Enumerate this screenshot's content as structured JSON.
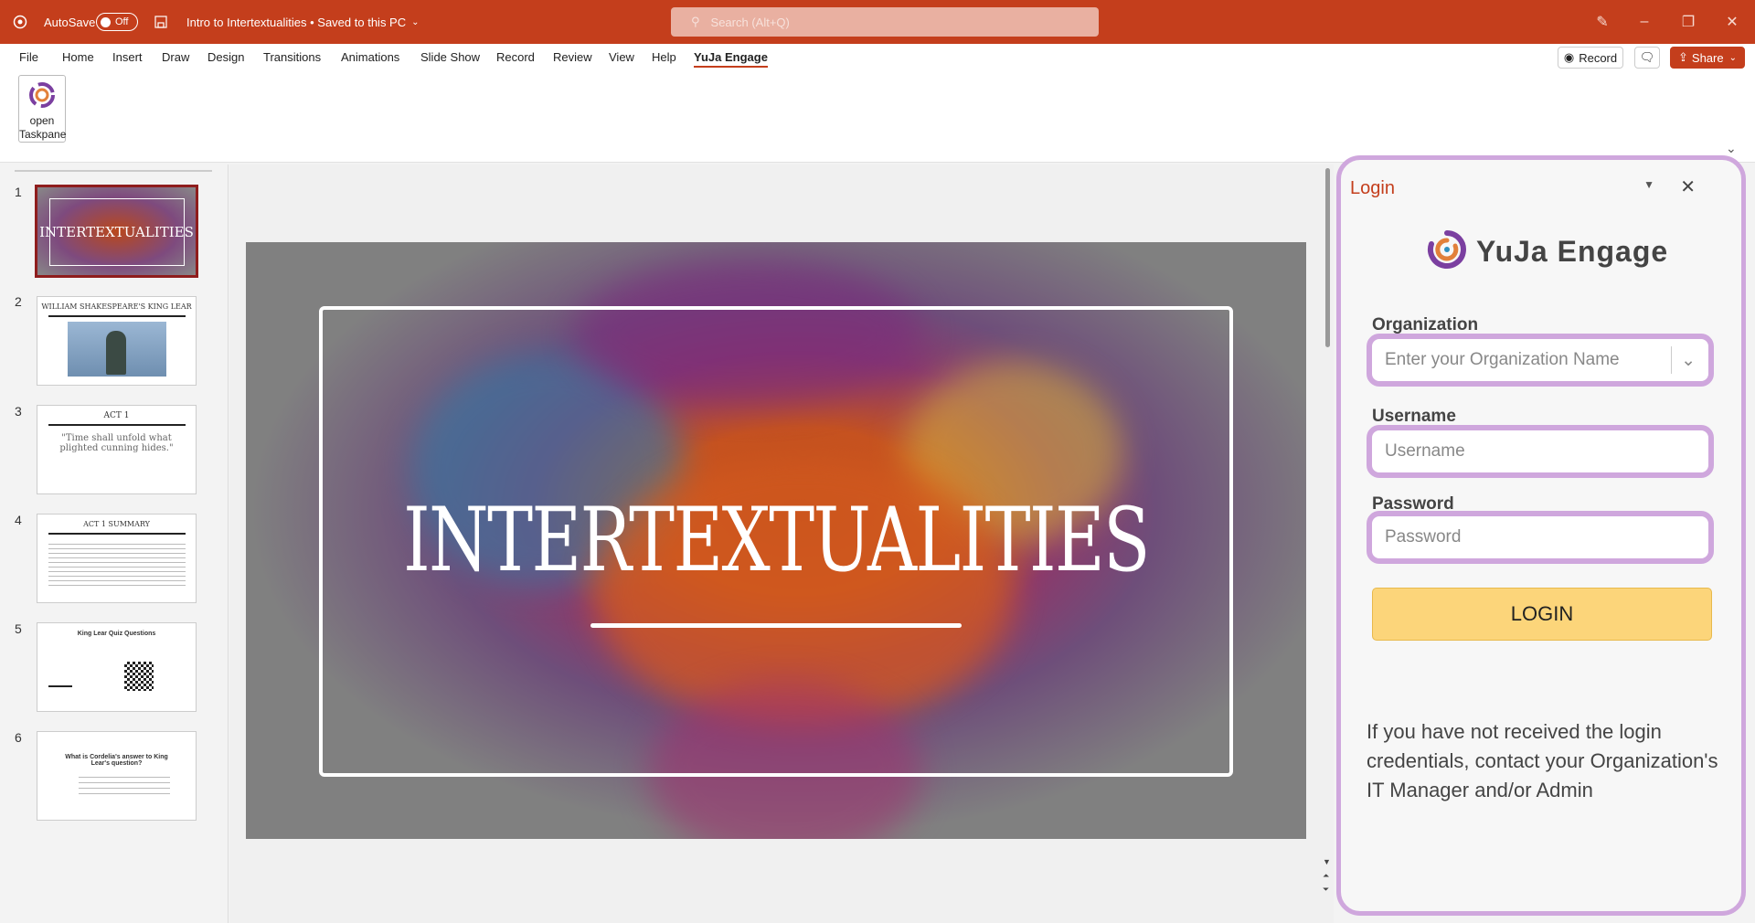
{
  "titlebar": {
    "autosave_label": "AutoSave",
    "autosave_state": "Off",
    "document_title": "Intro to Intertextualities • Saved to this PC",
    "search_placeholder": "Search (Alt+Q)"
  },
  "menu": {
    "tabs": [
      "File",
      "Home",
      "Insert",
      "Draw",
      "Design",
      "Transitions",
      "Animations",
      "Slide Show",
      "Record",
      "Review",
      "View",
      "Help",
      "YuJa Engage"
    ],
    "active_tab": "YuJa Engage",
    "record_label": "Record",
    "share_label": "Share"
  },
  "ribbon": {
    "taskpane_line1": "open",
    "taskpane_line2": "Taskpane"
  },
  "slides": [
    {
      "num": "1",
      "title": "INTERTEXTUALITIES"
    },
    {
      "num": "2",
      "title": "WILLIAM SHAKESPEARE'S KING LEAR"
    },
    {
      "num": "3",
      "title": "ACT 1",
      "quote": "\"Time shall unfold what plighted cunning hides.\""
    },
    {
      "num": "4",
      "title": "ACT 1 SUMMARY"
    },
    {
      "num": "5",
      "title": "King Lear Quiz Questions"
    },
    {
      "num": "6",
      "title": "What is Cordelia's answer to King Lear's question?"
    }
  ],
  "main_slide": {
    "title": "INTERTEXTUALITIES"
  },
  "panel": {
    "header": "Login",
    "brand": "YuJa Engage",
    "org_label": "Organization",
    "org_placeholder": "Enter your Organization Name",
    "username_label": "Username",
    "username_placeholder": "Username",
    "password_label": "Password",
    "password_placeholder": "Password",
    "login_button": "LOGIN",
    "info_text": "If you have not received the login credentials, contact your Organization's IT Manager and/or Admin"
  },
  "colors": {
    "accent": "#c43e1c",
    "panel_highlight": "#cfa7dd",
    "login_button": "#fcd57a"
  }
}
